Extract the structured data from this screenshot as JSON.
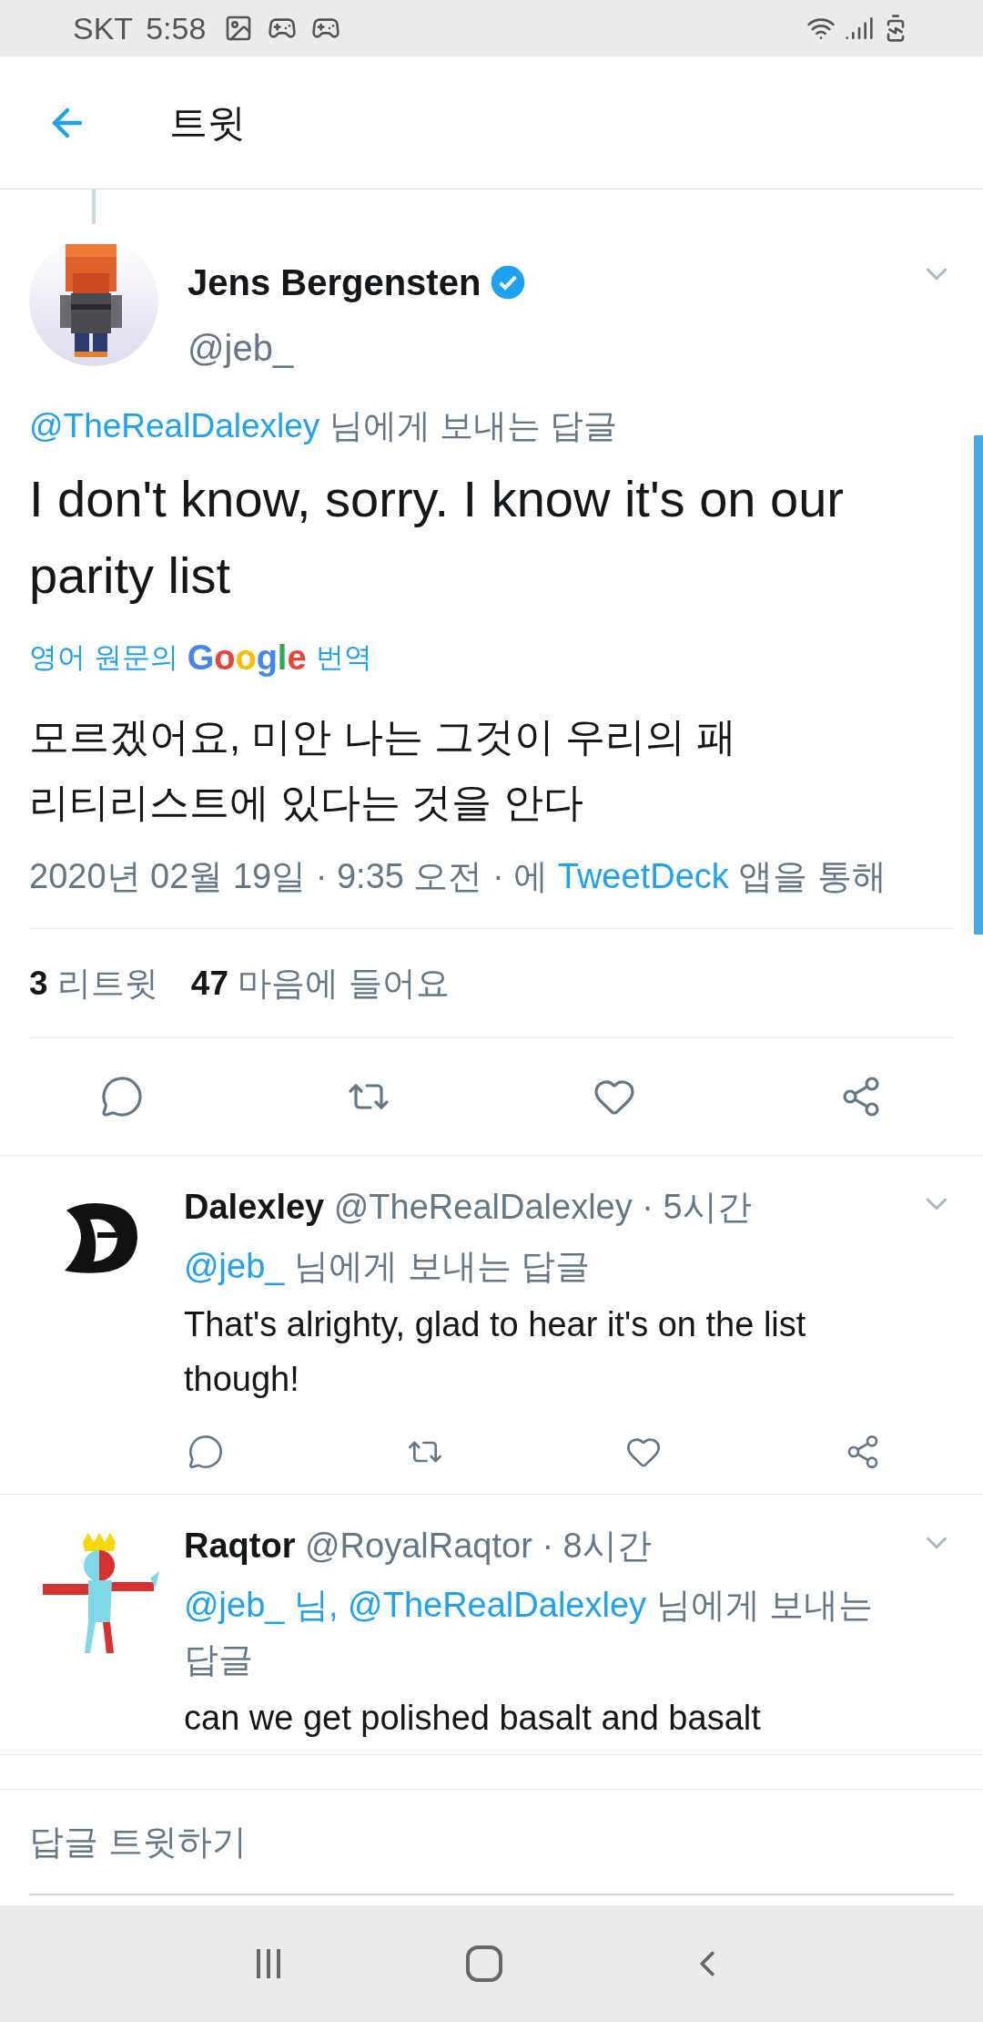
{
  "status_bar": {
    "carrier": "SKT",
    "time": "5:58"
  },
  "header": {
    "title": "트윗"
  },
  "tweet": {
    "name": "Jens Bergensten",
    "verified": true,
    "handle": "@jeb_",
    "reply_to": {
      "mentions": "@TheRealDalexley",
      "suffix": "님에게 보내는 답글"
    },
    "text": "I don't know, sorry. I know it's on our parity list",
    "translation_label": {
      "prefix": "영어 원문의",
      "brand": "Google",
      "suffix": "번역"
    },
    "translation": "모르겠어요, 미안 나는 그것이 우리의 패리티리스트에 있다는 것을 안다",
    "timestamp": {
      "date": "2020년 02월 19일 · 9:35 오전 · 에",
      "app": "TweetDeck",
      "suffix": "앱을 통해"
    },
    "stats": [
      {
        "count": "3",
        "label": "리트윗"
      },
      {
        "count": "47",
        "label": "마음에 들어요"
      }
    ]
  },
  "replies": [
    {
      "name": "Dalexley",
      "handle": "@TheRealDalexley",
      "time": "· 5시간",
      "reply_to": {
        "mentions": "@jeb_",
        "suffix": "님에게 보내는 답글"
      },
      "text": "That's alrighty, glad to hear it's on the list though!",
      "actions": true,
      "kind": "letter"
    },
    {
      "name": "Raqtor",
      "handle": "@RoyalRaqtor",
      "time": "· 8시간",
      "reply_to": {
        "mentions": "@jeb_ 님, @TheRealDalexley",
        "suffix": "님에게 보내는 답글"
      },
      "text": "can we get polished basalt and basalt",
      "actions": false,
      "kind": "figure"
    }
  ],
  "reply_box": {
    "placeholder": "답글 트윗하기"
  }
}
